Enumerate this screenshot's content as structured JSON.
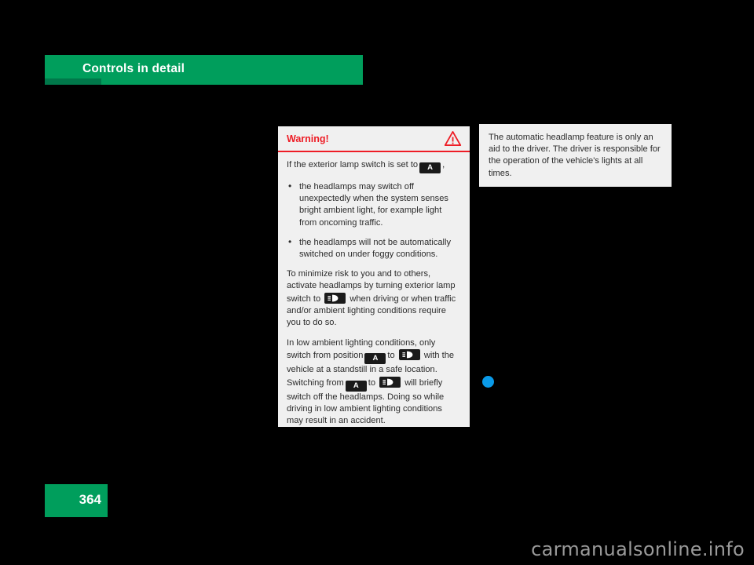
{
  "header": {
    "chapter_title": "Controls in detail",
    "bar_color": "#009E5C"
  },
  "warning": {
    "title": "Warning!",
    "icon": "warning-triangle-icon",
    "accent_color": "#ee1c25",
    "intro_before": "If the exterior lamp switch is set to",
    "intro_icon": "A",
    "intro_after": ",",
    "bullets": [
      "the headlamps may switch off unexpectedly when the system senses bright ambient light, for example light from oncoming traffic.",
      "the headlamps will not be automatically switched on under foggy conditions."
    ],
    "para2_a": "To minimize risk to you and to others, activate headlamps by turning exterior lamp switch to",
    "para2_icon": "headlamp",
    "para2_b": "when driving or when traffic and/or ambient lighting conditions require you to do so.",
    "para3_a": "In low ambient lighting conditions, only switch from position",
    "para3_icon1": "A",
    "para3_b": "to",
    "para3_icon2": "headlamp",
    "para3_c": "with the vehicle at a standstill in a safe location. Switching from",
    "para3_icon3": "A",
    "para3_d": "to",
    "para3_icon4": "headlamp",
    "para3_e": "will briefly switch off the headlamps. Doing so while driving in low ambient lighting conditions may result in an accident."
  },
  "info": {
    "text": "The automatic headlamp feature is only an aid to the driver. The driver is responsible for the operation of the vehicle's lights at all times."
  },
  "marker": {
    "name": "blue-dot-marker",
    "color": "#0a9ae8"
  },
  "footer": {
    "page_number": "364",
    "watermark": "carmanualsonline.info"
  }
}
